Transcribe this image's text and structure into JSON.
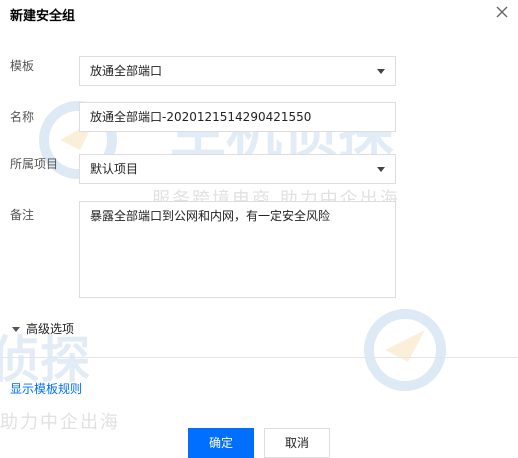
{
  "dialog": {
    "title": "新建安全组",
    "close_icon": "close-icon"
  },
  "form": {
    "template": {
      "label": "模板",
      "value": "放通全部端口"
    },
    "name": {
      "label": "名称",
      "value": "放通全部端口-2020121514290421550"
    },
    "project": {
      "label": "所属项目",
      "value": "默认项目"
    },
    "remark": {
      "label": "备注",
      "value": "暴露全部端口到公网和内网，有一定安全风险"
    }
  },
  "advanced_label": "高级选项",
  "show_rules_link": "显示模板规则",
  "buttons": {
    "confirm": "确定",
    "cancel": "取消"
  },
  "watermark": {
    "logo_text": "主机侦探",
    "slogan": "服务跨境电商 助力中企出海",
    "slogan_partial": "助力中企出海"
  },
  "colors": {
    "primary": "#006eff",
    "border": "#dddddd",
    "link": "#006eff"
  }
}
